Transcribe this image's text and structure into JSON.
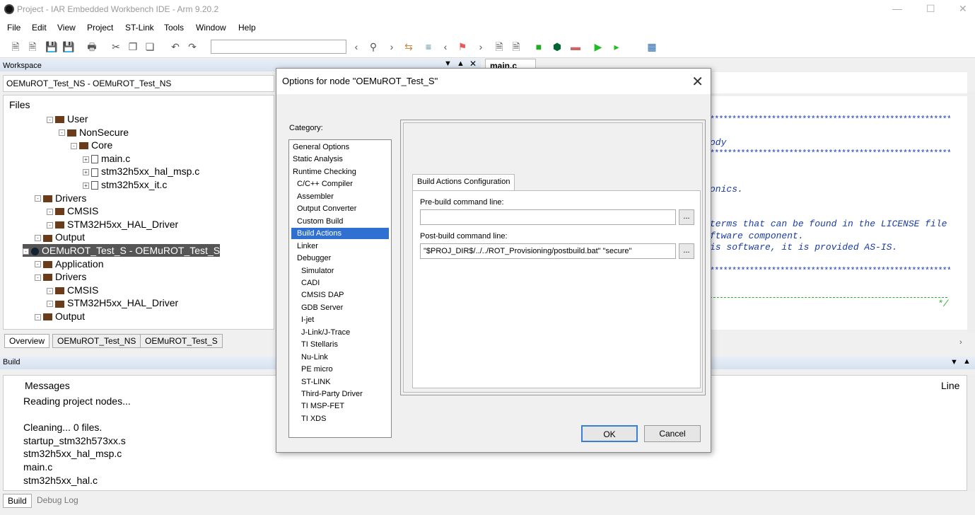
{
  "app": {
    "title": "Project - IAR Embedded Workbench IDE - Arm 9.20.2"
  },
  "menu": [
    "File",
    "Edit",
    "View",
    "Project",
    "ST-Link",
    "Tools",
    "Window",
    "Help"
  ],
  "workspace": {
    "title": "Workspace",
    "config": "OEMuROT_Test_NS - OEMuROT_Test_NS",
    "files_header": "Files",
    "tree": [
      {
        "label": "User",
        "type": "folder",
        "depth": 3
      },
      {
        "label": "NonSecure",
        "type": "folder",
        "depth": 4
      },
      {
        "label": "Core",
        "type": "folder",
        "depth": 5
      },
      {
        "label": "main.c",
        "type": "file",
        "depth": 6
      },
      {
        "label": "stm32h5xx_hal_msp.c",
        "type": "file",
        "depth": 6
      },
      {
        "label": "stm32h5xx_it.c",
        "type": "file",
        "depth": 6
      },
      {
        "label": "Drivers",
        "type": "folder",
        "depth": 2
      },
      {
        "label": "CMSIS",
        "type": "folder",
        "depth": 3
      },
      {
        "label": "STM32H5xx_HAL_Driver",
        "type": "folder",
        "depth": 3
      },
      {
        "label": "Output",
        "type": "folder",
        "depth": 2
      },
      {
        "label": "OEMuROT_Test_S - OEMuROT_Test_S",
        "type": "project",
        "depth": 1
      },
      {
        "label": "Application",
        "type": "folder",
        "depth": 2
      },
      {
        "label": "Drivers",
        "type": "folder",
        "depth": 2
      },
      {
        "label": "CMSIS",
        "type": "folder",
        "depth": 3
      },
      {
        "label": "STM32H5xx_HAL_Driver",
        "type": "folder",
        "depth": 3
      },
      {
        "label": "Output",
        "type": "folder",
        "depth": 2
      }
    ],
    "tabs": [
      "Overview",
      "OEMuROT_Test_NS",
      "OEMuROT_Test_S"
    ]
  },
  "editor": {
    "tab": "main.c",
    "lines": [
      {
        "text": "ody",
        "row": 3
      },
      {
        "text": "onics.",
        "row": 7
      },
      {
        "text": "terms that can be found in the LICENSE file",
        "row": 10
      },
      {
        "text": "ftware component.",
        "row": 11
      },
      {
        "text": "is software, it is provided AS-IS.",
        "row": 12
      }
    ],
    "comment_end": "*/"
  },
  "build": {
    "title": "Build",
    "col_messages": "Messages",
    "col_line": "Line",
    "messages": [
      "Reading project nodes...",
      "",
      "Cleaning... 0 files.",
      "startup_stm32h573xx.s",
      "stm32h5xx_hal_msp.c",
      "main.c",
      "stm32h5xx_hal.c"
    ]
  },
  "bottom_tabs": [
    "Build",
    "Debug Log"
  ],
  "dialog": {
    "title": "Options for node \"OEMuROT_Test_S\"",
    "category_label": "Category:",
    "categories": [
      {
        "label": "General Options",
        "indent": 0
      },
      {
        "label": "Static Analysis",
        "indent": 0
      },
      {
        "label": "Runtime Checking",
        "indent": 0
      },
      {
        "label": "C/C++ Compiler",
        "indent": 1
      },
      {
        "label": "Assembler",
        "indent": 1
      },
      {
        "label": "Output Converter",
        "indent": 1
      },
      {
        "label": "Custom Build",
        "indent": 1
      },
      {
        "label": "Build Actions",
        "indent": 1,
        "selected": true
      },
      {
        "label": "Linker",
        "indent": 1
      },
      {
        "label": "Debugger",
        "indent": 1
      },
      {
        "label": "Simulator",
        "indent": 2
      },
      {
        "label": "CADI",
        "indent": 2
      },
      {
        "label": "CMSIS DAP",
        "indent": 2
      },
      {
        "label": "GDB Server",
        "indent": 2
      },
      {
        "label": "I-jet",
        "indent": 2
      },
      {
        "label": "J-Link/J-Trace",
        "indent": 2
      },
      {
        "label": "TI Stellaris",
        "indent": 2
      },
      {
        "label": "Nu-Link",
        "indent": 2
      },
      {
        "label": "PE micro",
        "indent": 2
      },
      {
        "label": "ST-LINK",
        "indent": 2
      },
      {
        "label": "Third-Party Driver",
        "indent": 2
      },
      {
        "label": "TI MSP-FET",
        "indent": 2
      },
      {
        "label": "TI XDS",
        "indent": 2
      }
    ],
    "tab": "Build Actions Configuration",
    "prebuild_label": "Pre-build command line:",
    "prebuild_value": "",
    "postbuild_label": "Post-build command line:",
    "postbuild_value": "\"$PROJ_DIR$/../../ROT_Provisioning/postbuild.bat\" \"secure\"",
    "browse": "...",
    "ok": "OK",
    "cancel": "Cancel"
  }
}
